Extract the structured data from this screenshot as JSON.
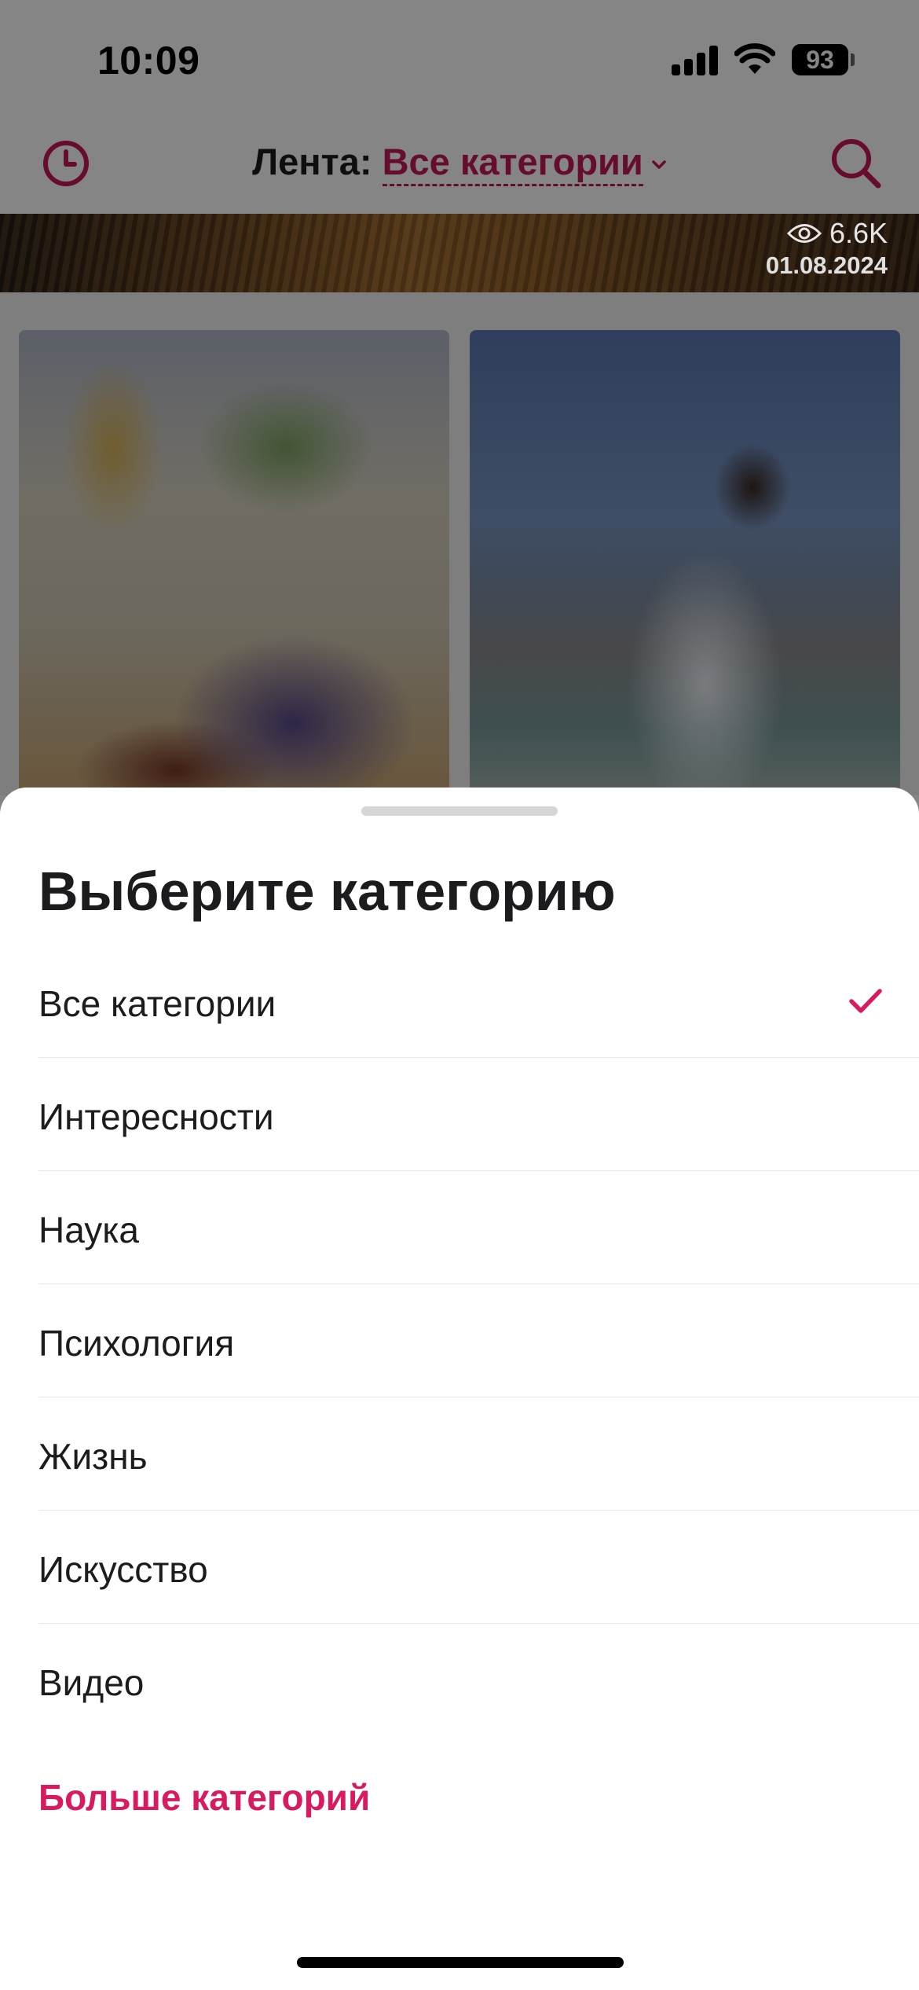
{
  "status_bar": {
    "time": "10:09",
    "battery": "93"
  },
  "header": {
    "title_prefix": "Лента:",
    "category": "Все категории"
  },
  "banner": {
    "views": "6.6K",
    "date": "01.08.2024"
  },
  "sheet": {
    "title": "Выберите категорию",
    "categories": [
      {
        "label": "Все категории",
        "selected": true
      },
      {
        "label": "Интересности",
        "selected": false
      },
      {
        "label": "Наука",
        "selected": false
      },
      {
        "label": "Психология",
        "selected": false
      },
      {
        "label": "Жизнь",
        "selected": false
      },
      {
        "label": "Искусство",
        "selected": false
      },
      {
        "label": "Видео",
        "selected": false
      }
    ],
    "more_label": "Больше категорий"
  },
  "icons": {
    "history": "clock-icon",
    "search": "search-icon",
    "selected": "checkmark-icon",
    "views": "eye-icon"
  },
  "colors": {
    "accent": "#c2185b",
    "link": "#d81b60",
    "overlay": "rgba(0,0,0,0.48)"
  }
}
